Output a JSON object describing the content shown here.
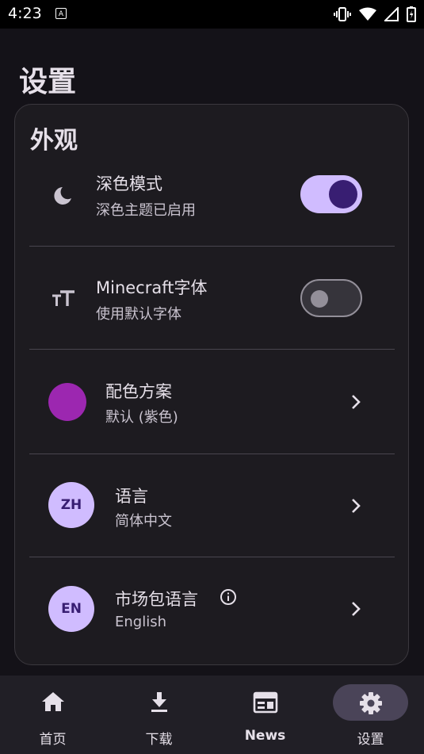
{
  "status_bar": {
    "time": "4:23",
    "app_icon_letter": "A"
  },
  "page": {
    "title": "设置"
  },
  "section": {
    "title": "外观"
  },
  "settings": {
    "dark_mode": {
      "title": "深色模式",
      "subtitle": "深色主题已启用",
      "enabled": true,
      "icon": "moon-icon"
    },
    "minecraft_font": {
      "title": "Minecraft字体",
      "subtitle": "使用默认字体",
      "enabled": false,
      "icon": "font-size-icon"
    },
    "color_scheme": {
      "title": "配色方案",
      "subtitle": "默认 (紫色)",
      "color": "#9c27b0"
    },
    "language": {
      "title": "语言",
      "subtitle": "简体中文",
      "badge": "ZH"
    },
    "market_language": {
      "title": "市场包语言",
      "subtitle": "English",
      "badge": "EN",
      "info_icon": "info-icon"
    }
  },
  "nav": {
    "items": [
      {
        "label": "首页",
        "icon": "home-icon"
      },
      {
        "label": "下载",
        "icon": "download-icon"
      },
      {
        "label": "News",
        "icon": "news-icon"
      },
      {
        "label": "设置",
        "icon": "gear-icon",
        "active": true
      }
    ]
  },
  "colors": {
    "background": "#141218",
    "card": "#1d1b20",
    "accent": "#d0bcff",
    "accent_dark": "#381e72"
  }
}
